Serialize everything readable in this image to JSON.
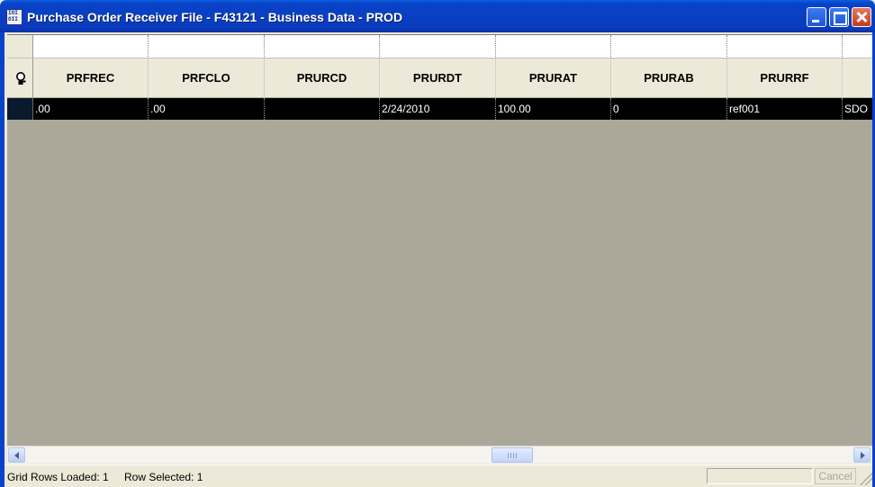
{
  "window": {
    "title": "Purchase Order Receiver File - F43121 - Business Data - PROD",
    "icon": "application-icon",
    "controls": [
      "minimize-icon",
      "maximize-icon",
      "close-icon"
    ]
  },
  "grid": {
    "selector_icon": "magnifier-icon",
    "columns": [
      "PRFREC",
      "PRFCLO",
      "PRURCD",
      "PRURDT",
      "PRURAT",
      "PRURAB",
      "PRURRF",
      ""
    ],
    "rows": [
      {
        "cells": [
          ".00",
          ".00",
          "",
          "2/24/2010",
          "100.00",
          "0",
          "ref001",
          "SDO"
        ]
      }
    ]
  },
  "scrollbar": {
    "left_icon": "scroll-left-icon",
    "right_icon": "scroll-right-icon"
  },
  "statusbar": {
    "rows_loaded": "Grid Rows Loaded:  1",
    "row_selected": "Row Selected:  1",
    "cancel_label": "Cancel"
  },
  "colors": {
    "titlebar": "#0a3fc1",
    "grid_background": "#aca899",
    "selected_row": "#000000",
    "header": "#ece9d8"
  }
}
